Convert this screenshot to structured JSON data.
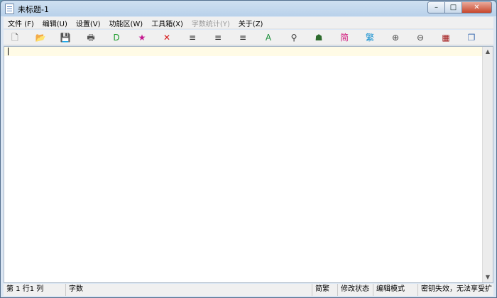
{
  "window": {
    "title": "未标题-1",
    "min": "–",
    "max": "□",
    "close": "✕"
  },
  "menu": [
    {
      "label": "文件 (F)",
      "enabled": true
    },
    {
      "label": "编辑(U)",
      "enabled": true
    },
    {
      "label": "设置(V)",
      "enabled": true
    },
    {
      "label": "功能区(W)",
      "enabled": true
    },
    {
      "label": "工具箱(X)",
      "enabled": true
    },
    {
      "label": "字数统计(Y)",
      "enabled": false
    },
    {
      "label": "关于(Z)",
      "enabled": true
    }
  ],
  "toolbar": [
    {
      "icon": "new-document-icon",
      "glyph": "🗋",
      "color": "#555"
    },
    {
      "icon": "open-folder-icon",
      "glyph": "📂",
      "color": "#d9a21b"
    },
    {
      "icon": "save-icon",
      "glyph": "💾",
      "color": "#2b4ea0"
    },
    {
      "icon": "print-icon",
      "glyph": "🖶",
      "color": "#555"
    },
    {
      "icon": "d-icon",
      "glyph": "D",
      "color": "#1b9b2a"
    },
    {
      "icon": "star-box-icon",
      "glyph": "★",
      "color": "#c4168f"
    },
    {
      "icon": "delete-icon",
      "glyph": "✕",
      "color": "#d61818"
    },
    {
      "icon": "align-left-icon",
      "glyph": "≡",
      "color": "#222"
    },
    {
      "icon": "align-center-icon",
      "glyph": "≡",
      "color": "#222"
    },
    {
      "icon": "align-right-icon",
      "glyph": "≡",
      "color": "#222"
    },
    {
      "icon": "spell-check-icon",
      "glyph": "A",
      "color": "#1a8f3a"
    },
    {
      "icon": "find-icon",
      "glyph": "⚲",
      "color": "#333"
    },
    {
      "icon": "user-icon",
      "glyph": "☗",
      "color": "#2c6a2c"
    },
    {
      "icon": "simplified-chinese-icon",
      "glyph": "简",
      "color": "#d0167a"
    },
    {
      "icon": "traditional-chinese-icon",
      "glyph": "繁",
      "color": "#1590d0"
    },
    {
      "icon": "zoom-in-icon",
      "glyph": "⊕",
      "color": "#444"
    },
    {
      "icon": "zoom-out-icon",
      "glyph": "⊖",
      "color": "#444"
    },
    {
      "icon": "calendar-icon",
      "glyph": "▦",
      "color": "#a21b1b"
    },
    {
      "icon": "copy-icon",
      "glyph": "❐",
      "color": "#3a6ab0"
    }
  ],
  "status": {
    "position": "第 1 行1 列",
    "wordcount": "字数",
    "script": "简繁",
    "modified": "修改状态",
    "mode": "编辑模式",
    "license": "密钥失效，无法享受扩"
  }
}
